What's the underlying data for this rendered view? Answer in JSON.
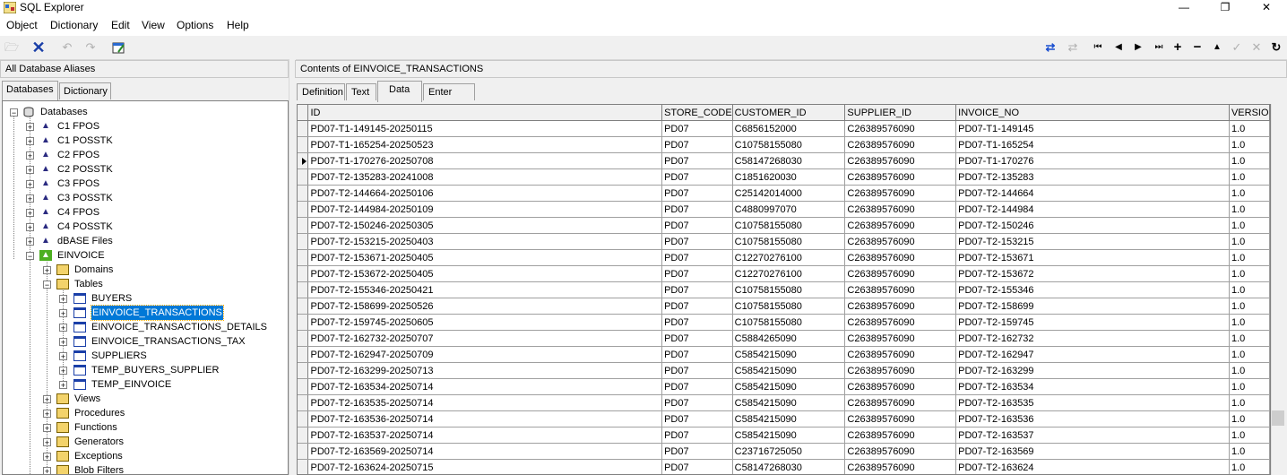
{
  "window": {
    "title": "SQL Explorer",
    "minimize": "—",
    "maximize": "❐",
    "close": "✕"
  },
  "menu": [
    "Object",
    "Dictionary",
    "Edit",
    "View",
    "Options",
    "Help"
  ],
  "left": {
    "header": "All Database Aliases",
    "tabs": [
      "Databases",
      "Dictionary"
    ],
    "tree": {
      "root": "Databases",
      "aliases": [
        "C1 FPOS",
        "C1 POSSTK",
        "C2 FPOS",
        "C2 POSSTK",
        "C3 FPOS",
        "C3 POSSTK",
        "C4 FPOS",
        "C4 POSSTK",
        "dBASE Files"
      ],
      "open_db": "EINVOICE",
      "sections": {
        "domains": "Domains",
        "tables": "Tables",
        "views": "Views",
        "procedures": "Procedures",
        "functions": "Functions",
        "generators": "Generators",
        "exceptions": "Exceptions",
        "blob_filters": "Blob Filters"
      },
      "tables": [
        "BUYERS",
        "EINVOICE_TRANSACTIONS",
        "EINVOICE_TRANSACTIONS_DETAILS",
        "EINVOICE_TRANSACTIONS_TAX",
        "SUPPLIERS",
        "TEMP_BUYERS_SUPPLIER",
        "TEMP_EINVOICE"
      ],
      "selected_table": "EINVOICE_TRANSACTIONS"
    }
  },
  "right": {
    "header": "Contents of EINVOICE_TRANSACTIONS",
    "tabs": [
      "Definition",
      "Text",
      "Data",
      "Enter SQL"
    ],
    "active_tab": "Data",
    "grid": {
      "columns": [
        "ID",
        "STORE_CODE",
        "CUSTOMER_ID",
        "SUPPLIER_ID",
        "INVOICE_NO",
        "VERSIO"
      ],
      "current_row": 2,
      "rows": [
        [
          "PD07-T1-149145-20250115",
          "PD07",
          "C6856152000",
          "C26389576090",
          "PD07-T1-149145",
          "1.0"
        ],
        [
          "PD07-T1-165254-20250523",
          "PD07",
          "C10758155080",
          "C26389576090",
          "PD07-T1-165254",
          "1.0"
        ],
        [
          "PD07-T1-170276-20250708",
          "PD07",
          "C58147268030",
          "C26389576090",
          "PD07-T1-170276",
          "1.0"
        ],
        [
          "PD07-T2-135283-20241008",
          "PD07",
          "C1851620030",
          "C26389576090",
          "PD07-T2-135283",
          "1.0"
        ],
        [
          "PD07-T2-144664-20250106",
          "PD07",
          "C25142014000",
          "C26389576090",
          "PD07-T2-144664",
          "1.0"
        ],
        [
          "PD07-T2-144984-20250109",
          "PD07",
          "C4880997070",
          "C26389576090",
          "PD07-T2-144984",
          "1.0"
        ],
        [
          "PD07-T2-150246-20250305",
          "PD07",
          "C10758155080",
          "C26389576090",
          "PD07-T2-150246",
          "1.0"
        ],
        [
          "PD07-T2-153215-20250403",
          "PD07",
          "C10758155080",
          "C26389576090",
          "PD07-T2-153215",
          "1.0"
        ],
        [
          "PD07-T2-153671-20250405",
          "PD07",
          "C12270276100",
          "C26389576090",
          "PD07-T2-153671",
          "1.0"
        ],
        [
          "PD07-T2-153672-20250405",
          "PD07",
          "C12270276100",
          "C26389576090",
          "PD07-T2-153672",
          "1.0"
        ],
        [
          "PD07-T2-155346-20250421",
          "PD07",
          "C10758155080",
          "C26389576090",
          "PD07-T2-155346",
          "1.0"
        ],
        [
          "PD07-T2-158699-20250526",
          "PD07",
          "C10758155080",
          "C26389576090",
          "PD07-T2-158699",
          "1.0"
        ],
        [
          "PD07-T2-159745-20250605",
          "PD07",
          "C10758155080",
          "C26389576090",
          "PD07-T2-159745",
          "1.0"
        ],
        [
          "PD07-T2-162732-20250707",
          "PD07",
          "C5884265090",
          "C26389576090",
          "PD07-T2-162732",
          "1.0"
        ],
        [
          "PD07-T2-162947-20250709",
          "PD07",
          "C5854215090",
          "C26389576090",
          "PD07-T2-162947",
          "1.0"
        ],
        [
          "PD07-T2-163299-20250713",
          "PD07",
          "C5854215090",
          "C26389576090",
          "PD07-T2-163299",
          "1.0"
        ],
        [
          "PD07-T2-163534-20250714",
          "PD07",
          "C5854215090",
          "C26389576090",
          "PD07-T2-163534",
          "1.0"
        ],
        [
          "PD07-T2-163535-20250714",
          "PD07",
          "C5854215090",
          "C26389576090",
          "PD07-T2-163535",
          "1.0"
        ],
        [
          "PD07-T2-163536-20250714",
          "PD07",
          "C5854215090",
          "C26389576090",
          "PD07-T2-163536",
          "1.0"
        ],
        [
          "PD07-T2-163537-20250714",
          "PD07",
          "C5854215090",
          "C26389576090",
          "PD07-T2-163537",
          "1.0"
        ],
        [
          "PD07-T2-163569-20250714",
          "PD07",
          "C23716725050",
          "C26389576090",
          "PD07-T2-163569",
          "1.0"
        ],
        [
          "PD07-T2-163624-20250715",
          "PD07",
          "C58147268030",
          "C26389576090",
          "PD07-T2-163624",
          "1.0"
        ]
      ]
    }
  }
}
